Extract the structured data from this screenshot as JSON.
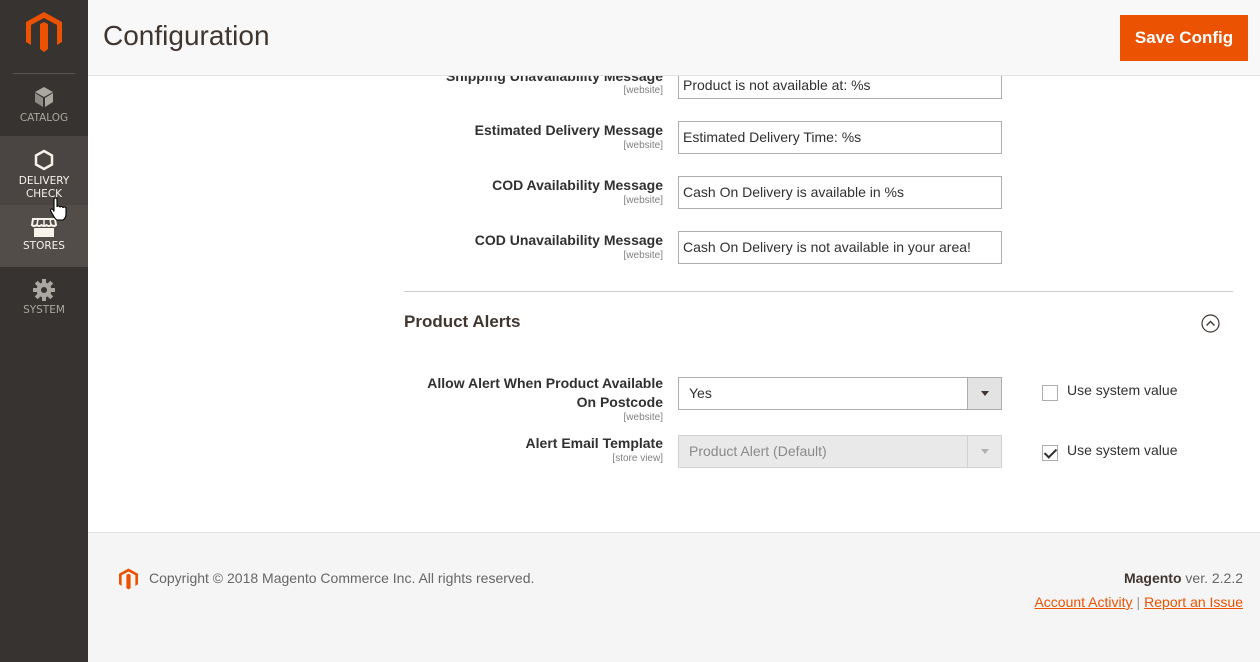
{
  "sidebar": {
    "items": [
      {
        "label": "CATALOG"
      },
      {
        "label": "DELIVERY CHECK"
      },
      {
        "label": "STORES"
      },
      {
        "label": "SYSTEM"
      }
    ]
  },
  "header": {
    "title": "Configuration",
    "save_label": "Save Config"
  },
  "fields": [
    {
      "label": "Shipping Unavailability Message",
      "scope": "[website]",
      "value": "Product is not available at: %s"
    },
    {
      "label": "Estimated Delivery Message",
      "scope": "[website]",
      "value": "Estimated Delivery Time: %s"
    },
    {
      "label": "COD Availability Message",
      "scope": "[website]",
      "value": "Cash On Delivery is available in %s"
    },
    {
      "label": "COD Unavailability Message",
      "scope": "[website]",
      "value": "Cash On Delivery is not available in your area!"
    }
  ],
  "product_alerts": {
    "title": "Product Alerts",
    "allow_alert": {
      "label_line1": "Allow Alert When Product Available",
      "label_line2": "On Postcode",
      "scope": "[website]",
      "value": "Yes",
      "use_system_label": "Use system value",
      "use_system_checked": false
    },
    "email_template": {
      "label": "Alert Email Template",
      "scope": "[store view]",
      "value": "Product Alert (Default)",
      "use_system_label": "Use system value",
      "use_system_checked": true
    }
  },
  "footer": {
    "copyright": "Copyright © 2018 Magento Commerce Inc. All rights reserved.",
    "brand": "Magento",
    "version": " ver. 2.2.2",
    "link_activity": "Account Activity",
    "separator": "|",
    "link_issue": "Report an Issue"
  },
  "colors": {
    "accent": "#eb5202",
    "sidebar_bg": "#373330"
  }
}
